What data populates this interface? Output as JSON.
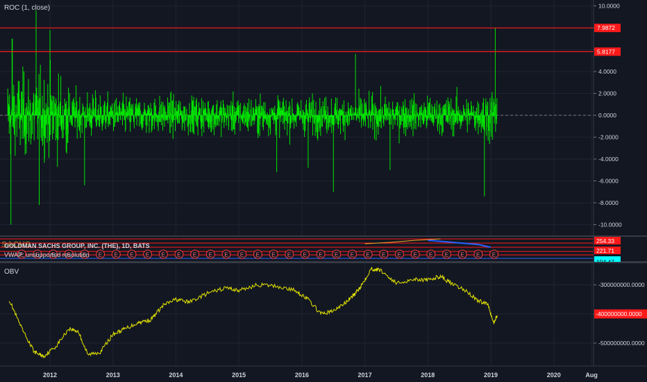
{
  "panes": {
    "roc": {
      "label": "ROC (1, close)",
      "y_ticks": [
        "10.0000",
        "8.0000",
        "6.0000",
        "4.0000",
        "2.0000",
        "0.0000",
        "-2.0000",
        "-4.0000",
        "-6.0000",
        "-8.0000",
        "-10.0000"
      ],
      "tag_upper": "7.9872",
      "tag_lower": "5.8177"
    },
    "price": {
      "label": "GOLDMAN SACHS GROUP, INC. (THE), 1D, BATS",
      "vwap_label": "VWAP: unsupported resolution",
      "watermark": "SACHS",
      "tag_1": "254.33",
      "tag_2": "221.71",
      "tag_3": "194.47",
      "earnings_marker": "E"
    },
    "obv": {
      "label": "OBV",
      "y_ticks": [
        "-300000000.0000",
        "-400000000.0000",
        "-500000000.0000"
      ],
      "tag_value": "-400000000.0000"
    },
    "x_ticks": [
      "2012",
      "2013",
      "2014",
      "2015",
      "2016",
      "2017",
      "2018",
      "2019",
      "2020",
      "Aug"
    ]
  },
  "colors": {
    "background": "#131722",
    "roc": "#00e600",
    "hline": "#ff1a1a",
    "obv": "#e6e600",
    "tag_red": "#ff1a1a",
    "tag_cyan": "#00ffff"
  },
  "chart_data": [
    {
      "type": "bar",
      "title": "ROC (1, close)",
      "x_range": [
        "2011-04",
        "2020-09"
      ],
      "ylim": [
        -11,
        10.8
      ],
      "hlines": [
        7.9872,
        5.8177
      ],
      "zero_line": 0,
      "spikes": [
        {
          "x": 2011.38,
          "y": -10.0
        },
        {
          "x": 2011.4,
          "y": 7.0
        },
        {
          "x": 2011.78,
          "y": 9.6
        },
        {
          "x": 2011.83,
          "y": -8.2
        },
        {
          "x": 2012.0,
          "y": 7.8
        },
        {
          "x": 2012.55,
          "y": -6.4
        },
        {
          "x": 2015.6,
          "y": -5.2
        },
        {
          "x": 2016.1,
          "y": -4.8
        },
        {
          "x": 2016.5,
          "y": -7.0
        },
        {
          "x": 2016.85,
          "y": 5.6
        },
        {
          "x": 2017.4,
          "y": -5.0
        },
        {
          "x": 2018.9,
          "y": -7.4
        },
        {
          "x": 2019.07,
          "y": 7.99
        }
      ],
      "grid": true
    },
    {
      "type": "line",
      "title": "OBV",
      "x_range": [
        "2011-04",
        "2020-09"
      ],
      "ylim": [
        -580000000,
        -235000000
      ],
      "series": [
        {
          "x": [
            2011.35,
            2011.55,
            2011.75,
            2011.9,
            2012.1,
            2012.3,
            2012.45,
            2012.6,
            2012.8,
            2013.0,
            2013.2,
            2013.4,
            2013.6,
            2013.8,
            2014.0,
            2014.2,
            2014.5,
            2014.8,
            2015.0,
            2015.3,
            2015.6,
            2015.9,
            2016.1,
            2016.3,
            2016.5,
            2016.7,
            2016.85,
            2016.95,
            2017.1,
            2017.25,
            2017.5,
            2017.8,
            2018.0,
            2018.2,
            2018.4,
            2018.6,
            2018.8,
            2018.95,
            2019.05,
            2019.1
          ],
          "y": [
            -350000000,
            -450000000,
            -530000000,
            -545000000,
            -510000000,
            -450000000,
            -460000000,
            -540000000,
            -530000000,
            -470000000,
            -450000000,
            -430000000,
            -420000000,
            -370000000,
            -350000000,
            -360000000,
            -330000000,
            -310000000,
            -320000000,
            -300000000,
            -305000000,
            -320000000,
            -350000000,
            -400000000,
            -390000000,
            -360000000,
            -330000000,
            -300000000,
            -245000000,
            -250000000,
            -295000000,
            -280000000,
            -285000000,
            -270000000,
            -300000000,
            -320000000,
            -355000000,
            -365000000,
            -430000000,
            -405000000
          ]
        }
      ],
      "grid": true
    }
  ]
}
